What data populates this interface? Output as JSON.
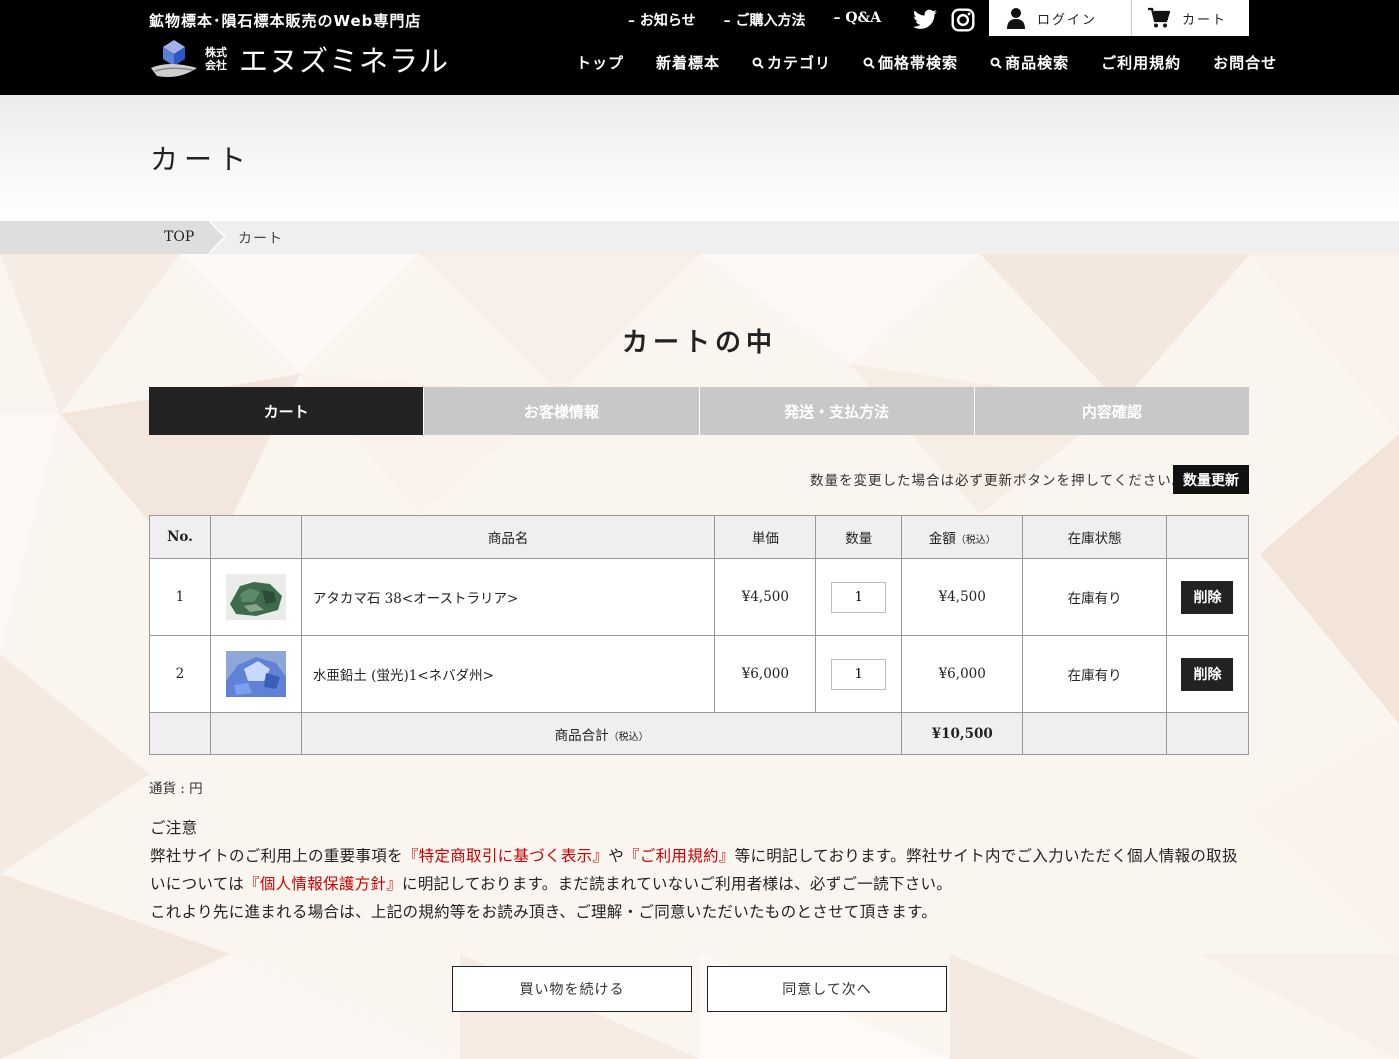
{
  "header": {
    "tagline": "鉱物標本･隕石標本販売のWeb専門店",
    "logo_kabushiki": "株式会社",
    "logo_name": "エヌズミネラル",
    "top_links": [
      "– お知らせ",
      "– ご購入方法",
      "– Q&A"
    ],
    "sns": [
      "twitter-icon",
      "instagram-icon"
    ],
    "login_label": "ログイン",
    "cart_label": "カート",
    "nav": [
      {
        "label": "トップ",
        "icon": ""
      },
      {
        "label": "新着標本",
        "icon": ""
      },
      {
        "label": "カテゴリ",
        "icon": "search-icon"
      },
      {
        "label": "価格帯検索",
        "icon": "search-icon"
      },
      {
        "label": "商品検索",
        "icon": "search-icon"
      },
      {
        "label": "ご利用規約",
        "icon": ""
      },
      {
        "label": "お問合せ",
        "icon": ""
      }
    ]
  },
  "page_title": "カート",
  "breadcrumb": {
    "top": "TOP",
    "current": "カート"
  },
  "section_title": "カートの中",
  "steps": [
    {
      "label": "カート",
      "active": true
    },
    {
      "label": "お客様情報",
      "active": false
    },
    {
      "label": "発送・支払方法",
      "active": false
    },
    {
      "label": "内容確認",
      "active": false
    }
  ],
  "update_note": "数量を変更した場合は必ず更新ボタンを押してください。",
  "update_button": "数量更新",
  "table": {
    "headers": {
      "no": "No.",
      "image": "",
      "name": "商品名",
      "unit_price": "単価",
      "qty": "数量",
      "amount": "金額",
      "amount_note": "（税込）",
      "stock": "在庫状態",
      "action": ""
    },
    "rows": [
      {
        "no": "1",
        "name": "アタカマ石 38<オーストラリア>",
        "unit_price": "¥4,500",
        "qty": "1",
        "amount": "¥4,500",
        "stock": "在庫有り",
        "delete": "削除",
        "thumb_color": "#3f6b4c"
      },
      {
        "no": "2",
        "name": "水亜鉛土 (蛍光)1<ネバダ州>",
        "unit_price": "¥6,000",
        "qty": "1",
        "amount": "¥6,000",
        "stock": "在庫有り",
        "delete": "削除",
        "thumb_color": "#6a8ee0"
      }
    ],
    "subtotal_label": "商品合計",
    "subtotal_note": "（税込）",
    "subtotal_value": "¥10,500"
  },
  "currency": "通貨 : 円",
  "notice": {
    "heading": "ご注意",
    "p1_a": "弊社サイトのご利用上の重要事項を",
    "p1_link1": "『特定商取引に基づく表示』",
    "p1_b": "や",
    "p1_link2": "『ご利用規約』",
    "p1_c": "等に明記しております。弊社サイト内でご入力いただく個人情報の取扱いについては",
    "p1_link3": "『個人情報保護方針』",
    "p1_d": "に明記しております。まだ読まれていないご利用者様は、必ずご一読下さい。",
    "p2": "これより先に進まれる場合は、上記の規約等をお読み頂き、ご理解・ご同意いただいたものとさせて頂きます。"
  },
  "buttons": {
    "continue": "買い物を続ける",
    "next": "同意して次へ"
  }
}
